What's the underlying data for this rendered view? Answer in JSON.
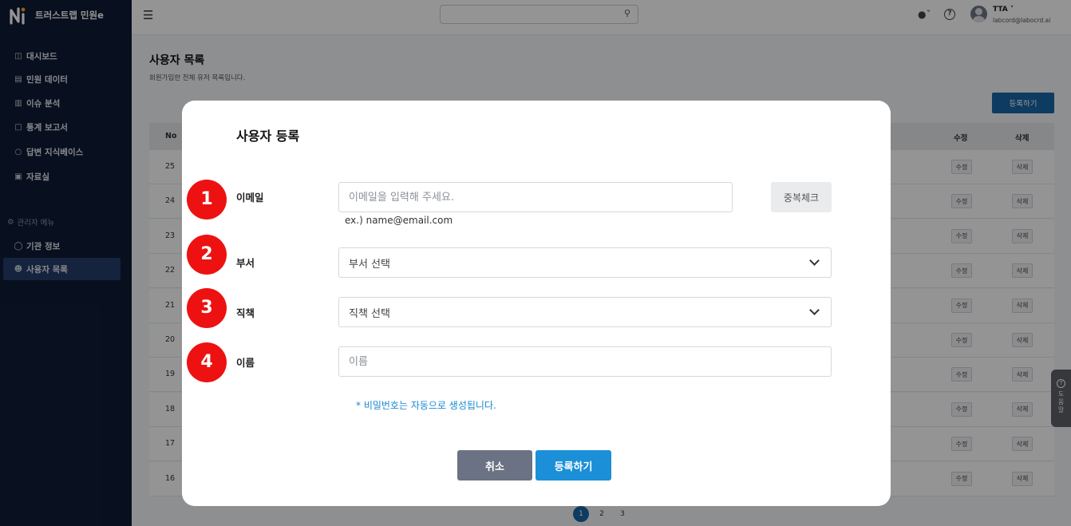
{
  "app": {
    "name": "트러스트랩 민원e"
  },
  "sidebar": {
    "items": [
      {
        "icon": "dashboard-icon",
        "label": "대시보드"
      },
      {
        "icon": "document-icon",
        "label": "민원 데이터"
      },
      {
        "icon": "bar-chart-icon",
        "label": "이슈 분석"
      },
      {
        "icon": "clipboard-icon",
        "label": "통계 보고서"
      },
      {
        "icon": "chat-icon",
        "label": "답변 지식베이스"
      },
      {
        "icon": "archive-icon",
        "label": "자료실"
      }
    ],
    "admin_section": "관리자 메뉴",
    "admin_items": [
      {
        "icon": "lightbulb-icon",
        "label": "기관 정보"
      },
      {
        "icon": "users-icon",
        "label": "사용자 목록",
        "active": true
      }
    ]
  },
  "topbar": {
    "user_name": "TTA",
    "user_email": "labcord@labocrd.ai"
  },
  "page": {
    "title": "사용자 목록",
    "subtitle": "회원가입한 전체 유저 목록입니다.",
    "register_button": "등록하기",
    "table": {
      "headers": {
        "no": "No",
        "edit": "수정",
        "delete": "삭제"
      },
      "rows": [
        "25",
        "24",
        "23",
        "22",
        "21",
        "20",
        "19",
        "18",
        "17",
        "16"
      ],
      "edit_label": "수정",
      "delete_label": "삭제"
    },
    "pagination": [
      "1",
      "2",
      "3"
    ],
    "current_page": "1",
    "help_tab": "도움말"
  },
  "modal": {
    "title": "사용자 등록",
    "steps": [
      "1",
      "2",
      "3",
      "4"
    ],
    "email": {
      "label": "이메일",
      "placeholder": "이메일을 입력해 주세요.",
      "check_button": "중복체크",
      "hint": "ex.) name@email.com"
    },
    "department": {
      "label": "부서",
      "value": "부서 선택"
    },
    "position": {
      "label": "직책",
      "value": "직책 선택"
    },
    "name": {
      "label": "이름",
      "placeholder": "이름"
    },
    "notice": "* 비밀번호는 자동으로 생성됩니다.",
    "cancel_button": "취소",
    "submit_button": "등록하기"
  },
  "colors": {
    "sidebar_bg": "#0f1b35",
    "primary": "#1766a8",
    "step_badge": "#ee1111",
    "notice": "#1a8ad1"
  }
}
